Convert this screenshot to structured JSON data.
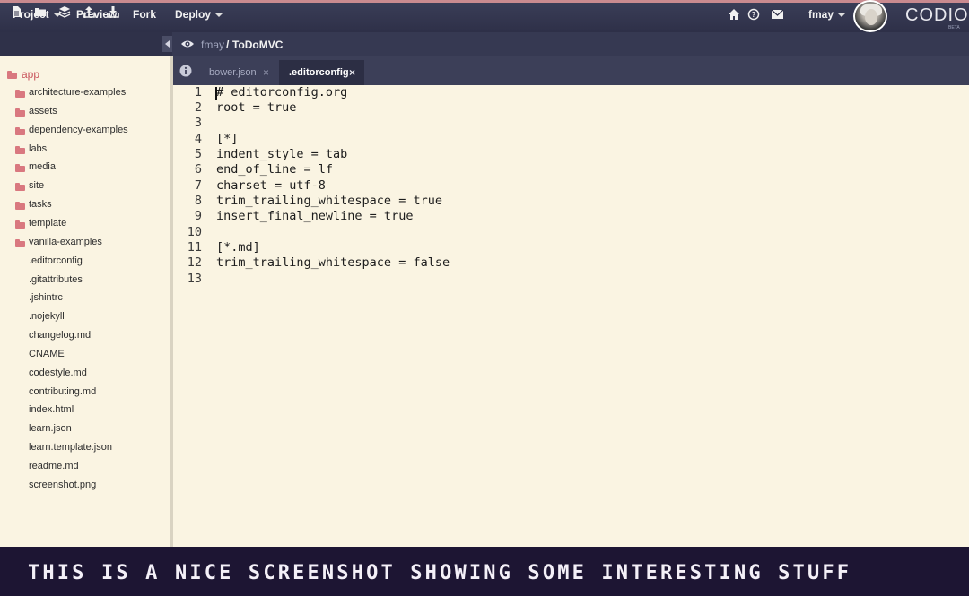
{
  "menu": {
    "project_label": "Project",
    "preview_label": "Preview",
    "fork_label": "Fork",
    "deploy_label": "Deploy"
  },
  "user": {
    "name": "fmay"
  },
  "brand": {
    "name": "CODIO",
    "tag": "BETA"
  },
  "breadcrumb": {
    "user": "fmay",
    "separator": "/",
    "project": "ToDoMVC"
  },
  "tree": {
    "root": "app",
    "folders": [
      "architecture-examples",
      "assets",
      "dependency-examples",
      "labs",
      "media",
      "site",
      "tasks",
      "template",
      "vanilla-examples"
    ],
    "files": [
      ".editorconfig",
      ".gitattributes",
      ".jshintrc",
      ".nojekyll",
      "changelog.md",
      "CNAME",
      "codestyle.md",
      "contributing.md",
      "index.html",
      "learn.json",
      "learn.template.json",
      "readme.md",
      "screenshot.png"
    ]
  },
  "tabs": [
    {
      "label": "bower.json",
      "active": false
    },
    {
      "label": ".editorconfig",
      "active": true
    }
  ],
  "tab_close_glyph": "×",
  "editor": {
    "lines": [
      "# editorconfig.org",
      "root = true",
      "",
      "[*]",
      "indent_style = tab",
      "end_of_line = lf",
      "charset = utf-8",
      "trim_trailing_whitespace = true",
      "insert_final_newline = true",
      "",
      "[*.md]",
      "trim_trailing_whitespace = false",
      ""
    ],
    "line_numbers": [
      "1",
      "2",
      "3",
      "4",
      "5",
      "6",
      "7",
      "8",
      "9",
      "10",
      "11",
      "12",
      "13"
    ]
  },
  "caption": "THIS IS A NICE SCREENSHOT SHOWING SOME INTERESTING STUFF",
  "colors": {
    "topbar": "#2e3048",
    "accent_stripe": "#c98a8f",
    "folder": "#d9787f",
    "root_folder_text": "#c9545c",
    "editor_bg": "#faf4e2",
    "caption_bg": "#1d1533"
  },
  "icons": {
    "toolbar": [
      "new-file-icon",
      "new-folder-icon",
      "layers-icon",
      "upload-icon",
      "download-icon"
    ],
    "top": [
      "home-icon",
      "help-icon",
      "mail-icon"
    ]
  }
}
